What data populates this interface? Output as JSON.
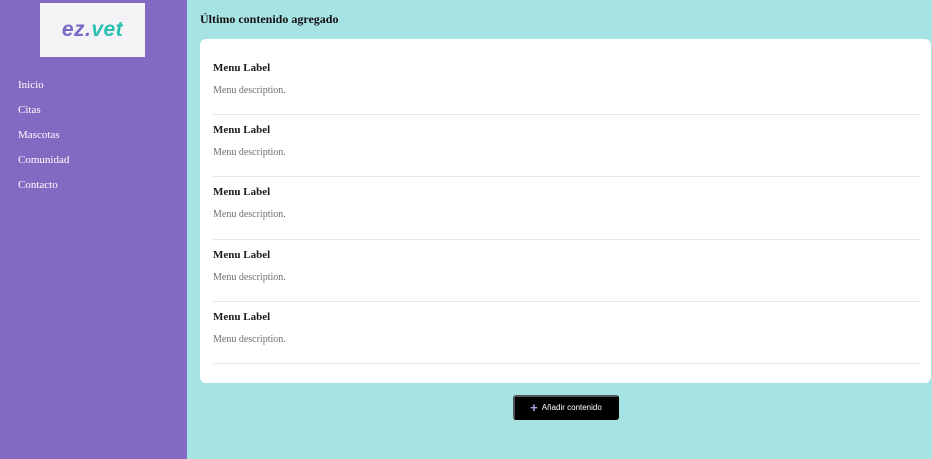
{
  "sidebar": {
    "logo": {
      "part1": "ez.",
      "part2": "vet"
    },
    "items": [
      {
        "label": "Inicio"
      },
      {
        "label": "Citas"
      },
      {
        "label": "Mascotas"
      },
      {
        "label": "Comunidad"
      },
      {
        "label": "Contacto"
      }
    ]
  },
  "main": {
    "title": "Último contenido agregado",
    "items": [
      {
        "label": "Menu Label",
        "description": "Menu description."
      },
      {
        "label": "Menu Label",
        "description": "Menu description."
      },
      {
        "label": "Menu Label",
        "description": "Menu description."
      },
      {
        "label": "Menu Label",
        "description": "Menu description."
      },
      {
        "label": "Menu Label",
        "description": "Menu description."
      }
    ],
    "add_button": {
      "icon": "+",
      "label": "Añadir contenido"
    }
  },
  "colors": {
    "sidebar_bg": "#8469c2",
    "page_bg": "#a8e3e4",
    "logo_primary": "#7a68c6",
    "logo_accent": "#2bbfb2",
    "button_bg": "#000000",
    "button_icon": "#b79cf2"
  }
}
